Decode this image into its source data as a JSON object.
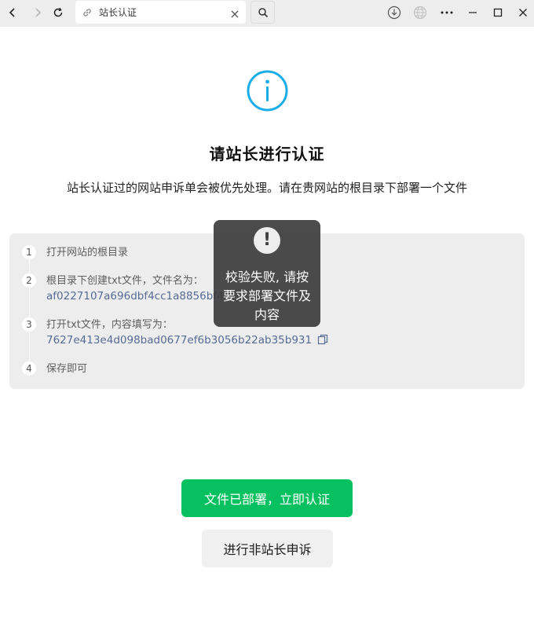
{
  "browser": {
    "tab_title": "站长认证",
    "icons": [
      "back-icon",
      "forward-icon",
      "reload-icon",
      "link-icon",
      "close-icon",
      "search-icon",
      "download-icon",
      "globe-icon",
      "more-icon",
      "minimize-icon",
      "maximize-icon",
      "window-close-icon"
    ]
  },
  "page": {
    "title": "请站长进行认证",
    "description": "站长认证过的网站申诉单会被优先处理。请在贵网站的根目录下部署一个文件",
    "steps": [
      {
        "num": "1",
        "text": "打开网站的根目录"
      },
      {
        "num": "2",
        "text": "根目录下创建txt文件，文件名为：",
        "code": "af0227107a696dbf4cc1a8856bf4"
      },
      {
        "num": "3",
        "text": "打开txt文件，内容填写为：",
        "code": "7627e413e4d098bad0677ef6b3056b22ab35b931"
      },
      {
        "num": "4",
        "text": "保存即可"
      }
    ],
    "primary_button": "文件已部署，立即认证",
    "secondary_button": "进行非站长申诉"
  },
  "toast": {
    "icon": "!",
    "message": "校验失败, 请按要求部署文件及内容"
  },
  "colors": {
    "accent": "#07c160",
    "info_icon": "#1aade8",
    "link_text": "#576b95",
    "toast_bg": "#3c3c3c"
  }
}
